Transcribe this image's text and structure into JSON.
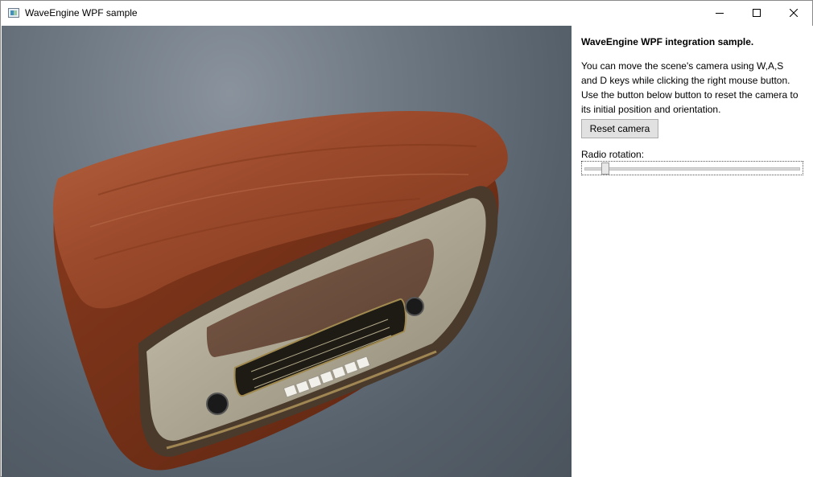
{
  "window": {
    "title": "WaveEngine WPF sample"
  },
  "panel": {
    "heading": "WaveEngine WPF integration sample.",
    "description": "You can move the scene's camera using W,A,S and D keys while clicking the right mouse button. Use the button below button to reset the camera to its initial position and orientation.",
    "reset_button_label": "Reset camera",
    "slider_label": "Radio rotation:",
    "slider_value_fraction": 0.08
  },
  "icons": {
    "app": "app-window-icon",
    "minimize": "minimize-icon",
    "maximize": "maximize-icon",
    "close": "close-icon"
  }
}
